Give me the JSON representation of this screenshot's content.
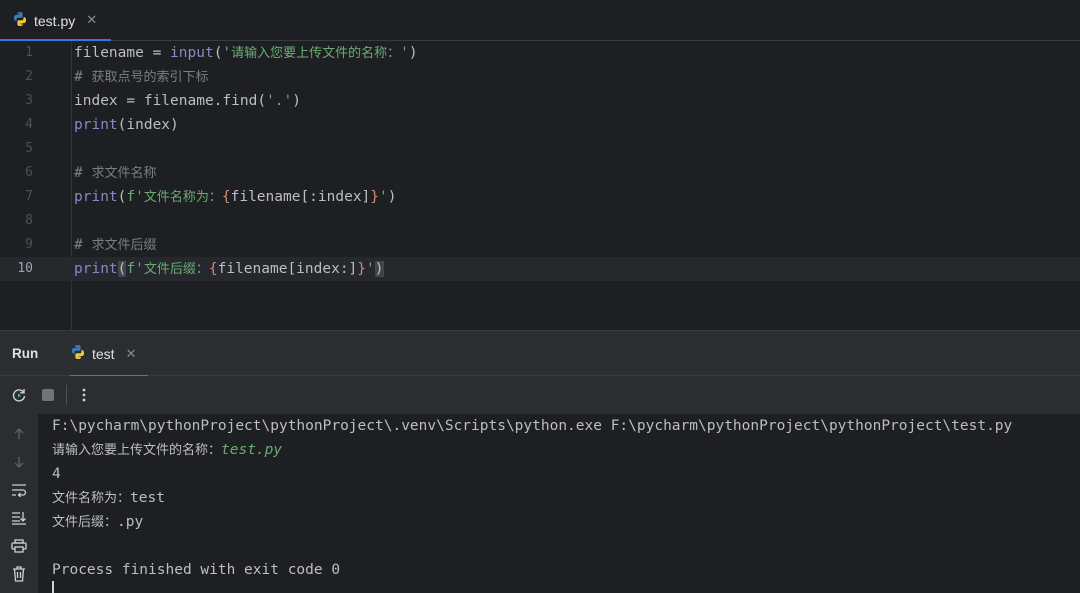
{
  "editor_tab": {
    "file_name": "test.py",
    "close_icon": "close-icon"
  },
  "code": {
    "current_line": 10,
    "lines": [
      {
        "n": "1",
        "parts": [
          [
            "",
            "filename = "
          ],
          [
            "kw-fn",
            "input"
          ],
          [
            "",
            "("
          ],
          [
            "str",
            "'"
          ],
          [
            "str cjk",
            "请输入您要上传文件的名称："
          ],
          [
            "str",
            "'"
          ],
          [
            "",
            ")"
          ]
        ]
      },
      {
        "n": "2",
        "parts": [
          [
            "cmt",
            "# "
          ],
          [
            "cmt cjk",
            "获取点号的索引下标"
          ]
        ]
      },
      {
        "n": "3",
        "parts": [
          [
            "",
            "index = filename.find("
          ],
          [
            "str",
            "'.'"
          ],
          [
            "",
            ")"
          ]
        ]
      },
      {
        "n": "4",
        "parts": [
          [
            "kw-fn",
            "print"
          ],
          [
            "",
            "(index)"
          ]
        ]
      },
      {
        "n": "5",
        "parts": []
      },
      {
        "n": "6",
        "parts": [
          [
            "cmt",
            "# "
          ],
          [
            "cmt cjk",
            "求文件名称"
          ]
        ]
      },
      {
        "n": "7",
        "parts": [
          [
            "kw-fn",
            "print"
          ],
          [
            "",
            "("
          ],
          [
            "str",
            "f'"
          ],
          [
            "str cjk",
            "文件名称为："
          ],
          [
            "brace",
            "{"
          ],
          [
            "",
            "filename[:index]"
          ],
          [
            "brace",
            "}"
          ],
          [
            "str",
            "'"
          ],
          [
            "",
            ")"
          ]
        ]
      },
      {
        "n": "8",
        "parts": []
      },
      {
        "n": "9",
        "parts": [
          [
            "cmt",
            "# "
          ],
          [
            "cmt cjk",
            "求文件后缀"
          ]
        ]
      },
      {
        "n": "10",
        "parts": [
          [
            "kw-fn",
            "print"
          ],
          [
            "paren-hl",
            "("
          ],
          [
            "str",
            "f'"
          ],
          [
            "str cjk",
            "文件后缀："
          ],
          [
            "brace",
            "{"
          ],
          [
            "",
            "filename[index:]"
          ],
          [
            "brace",
            "}"
          ],
          [
            "str",
            "'"
          ],
          [
            "paren-hl",
            ")"
          ]
        ]
      }
    ]
  },
  "run_panel": {
    "title": "Run",
    "tab_label": "test",
    "toolbar": {
      "rerun": "rerun-icon",
      "stop": "stop-icon",
      "more": "more-icon"
    },
    "side": [
      "arrow-up-icon",
      "arrow-down-icon",
      "soft-wrap-icon",
      "scroll-to-end-icon",
      "print-icon",
      "trash-icon"
    ]
  },
  "console": {
    "command": "F:\\pycharm\\pythonProject\\pythonProject\\.venv\\Scripts\\python.exe F:\\pycharm\\pythonProject\\pythonProject\\test.py",
    "prompt": "请输入您要上传文件的名称：",
    "user_input": "test.py",
    "out_index": "4",
    "name_label": "文件名称为：",
    "name_value": "test",
    "suffix_label": "文件后缀：",
    "suffix_value": ".py",
    "exit_message": "Process finished with exit code 0"
  },
  "colors": {
    "accent": "#3574f0",
    "string": "#6aab73",
    "builtin": "#8888c6",
    "comment": "#7a7e85",
    "brace": "#cf8e6d"
  }
}
